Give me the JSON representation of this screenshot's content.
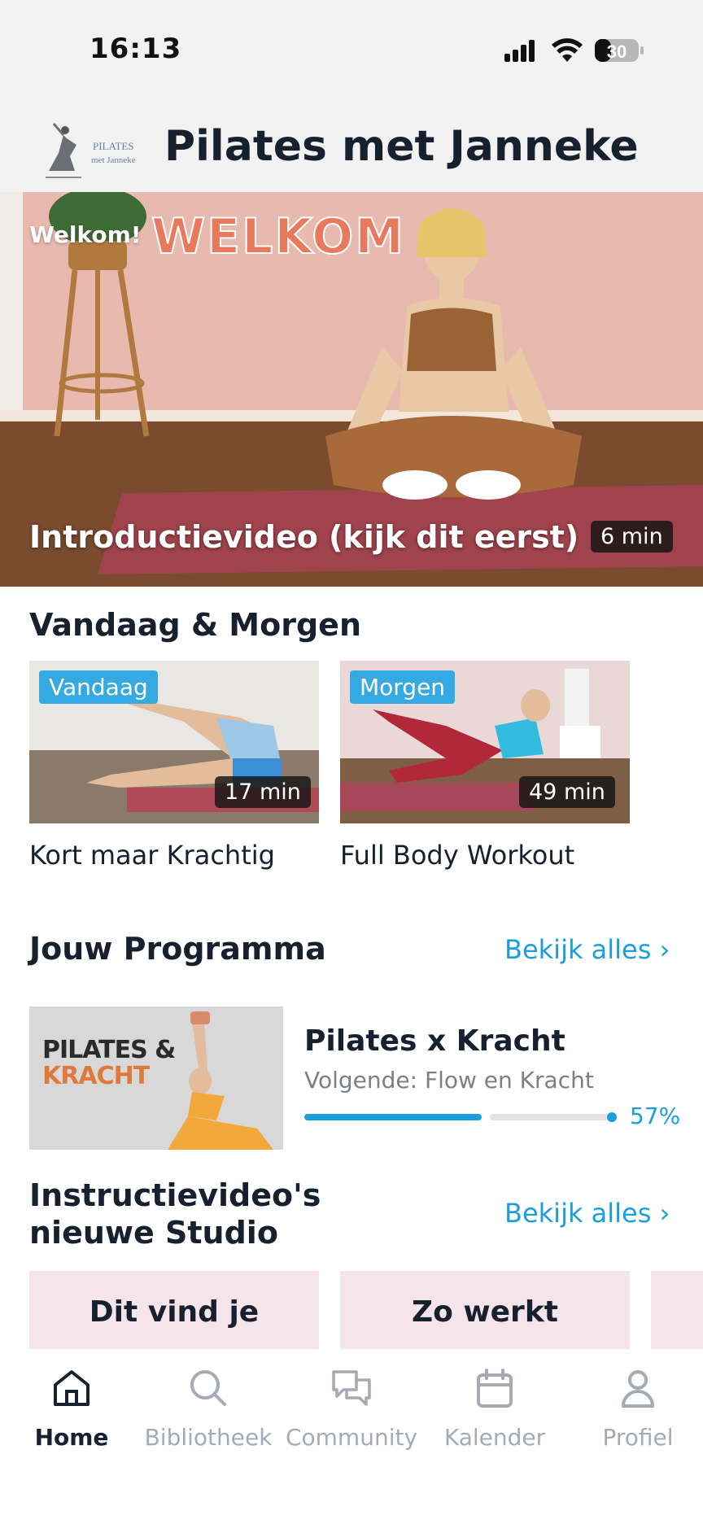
{
  "status_bar": {
    "time": "16:13",
    "battery_level": "30",
    "icons": [
      "signal-icon",
      "wifi-icon",
      "battery-icon"
    ]
  },
  "header": {
    "logo_text_line1": "PILATES",
    "logo_text_line2": "met Janneke",
    "title": "Pilates met Janneke"
  },
  "hero": {
    "overlay_small": "Welkom!",
    "overlay_big": "WELKOM",
    "title": "Introductievideo (kijk dit eerst)",
    "duration": "6 min"
  },
  "today_tomorrow": {
    "title": "Vandaag & Morgen",
    "cards": [
      {
        "badge": "Vandaag",
        "duration": "17 min",
        "label": "Kort maar Krachtig"
      },
      {
        "badge": "Morgen",
        "duration": "49 min",
        "label": "Full Body Workout"
      }
    ]
  },
  "program": {
    "section_title": "Jouw Programma",
    "see_all": "Bekijk alles",
    "thumb_line1": "PILATES &",
    "thumb_line2": "KRACHT",
    "name": "Pilates x Kracht",
    "next": "Volgende: Flow en Kracht",
    "progress_percent": 57,
    "progress_label": "57%"
  },
  "studio": {
    "title": "Instructievideo's nieuwe Studio",
    "see_all": "Bekijk alles",
    "cards": [
      {
        "text": "Dit vind je"
      },
      {
        "text": "Zo werkt"
      }
    ]
  },
  "tabbar": {
    "tabs": [
      {
        "label": "Home",
        "icon": "home-icon",
        "active": true
      },
      {
        "label": "Bibliotheek",
        "icon": "search-icon",
        "active": false
      },
      {
        "label": "Community",
        "icon": "chat-bubbles-icon",
        "active": false
      },
      {
        "label": "Kalender",
        "icon": "calendar-icon",
        "active": false
      },
      {
        "label": "Profiel",
        "icon": "person-icon",
        "active": false
      }
    ]
  },
  "colors": {
    "accent": "#1a9fdc",
    "badge": "#35a9e2",
    "text_dark": "#16202e",
    "tab_inactive": "#a6abb3"
  }
}
